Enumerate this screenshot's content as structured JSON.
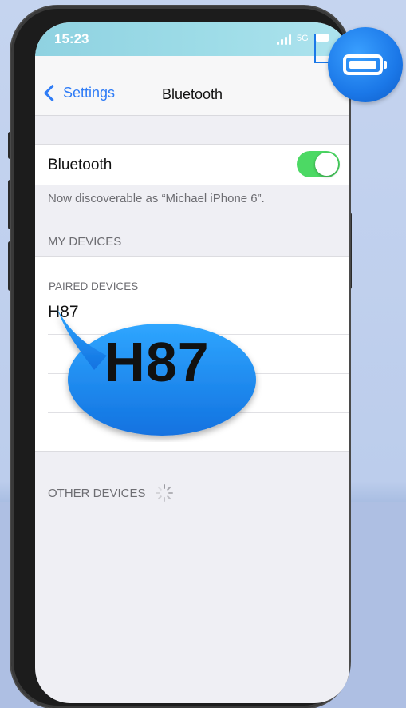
{
  "status_bar": {
    "time": "15:23",
    "network": "5G"
  },
  "nav": {
    "back_label": "Settings",
    "title": "Bluetooth"
  },
  "bluetooth": {
    "label": "Bluetooth",
    "enabled": true,
    "discoverable_text": "Now discoverable as “Michael iPhone 6”."
  },
  "my_devices": {
    "section_title": "MY DEVICES",
    "paired_header": "PAIRED DEVICES",
    "devices": [
      "H87"
    ]
  },
  "other_devices": {
    "section_title": "OTHER DEVICES"
  },
  "callout": {
    "text": "H87"
  },
  "colors": {
    "toggle_on": "#4cd964",
    "accent": "#2f7cf6",
    "callout_blue": "#1b78e8"
  },
  "icons": [
    "chevron-left-icon",
    "signal-icon",
    "battery-icon",
    "loading-spinner-icon",
    "battery-callout-icon"
  ]
}
